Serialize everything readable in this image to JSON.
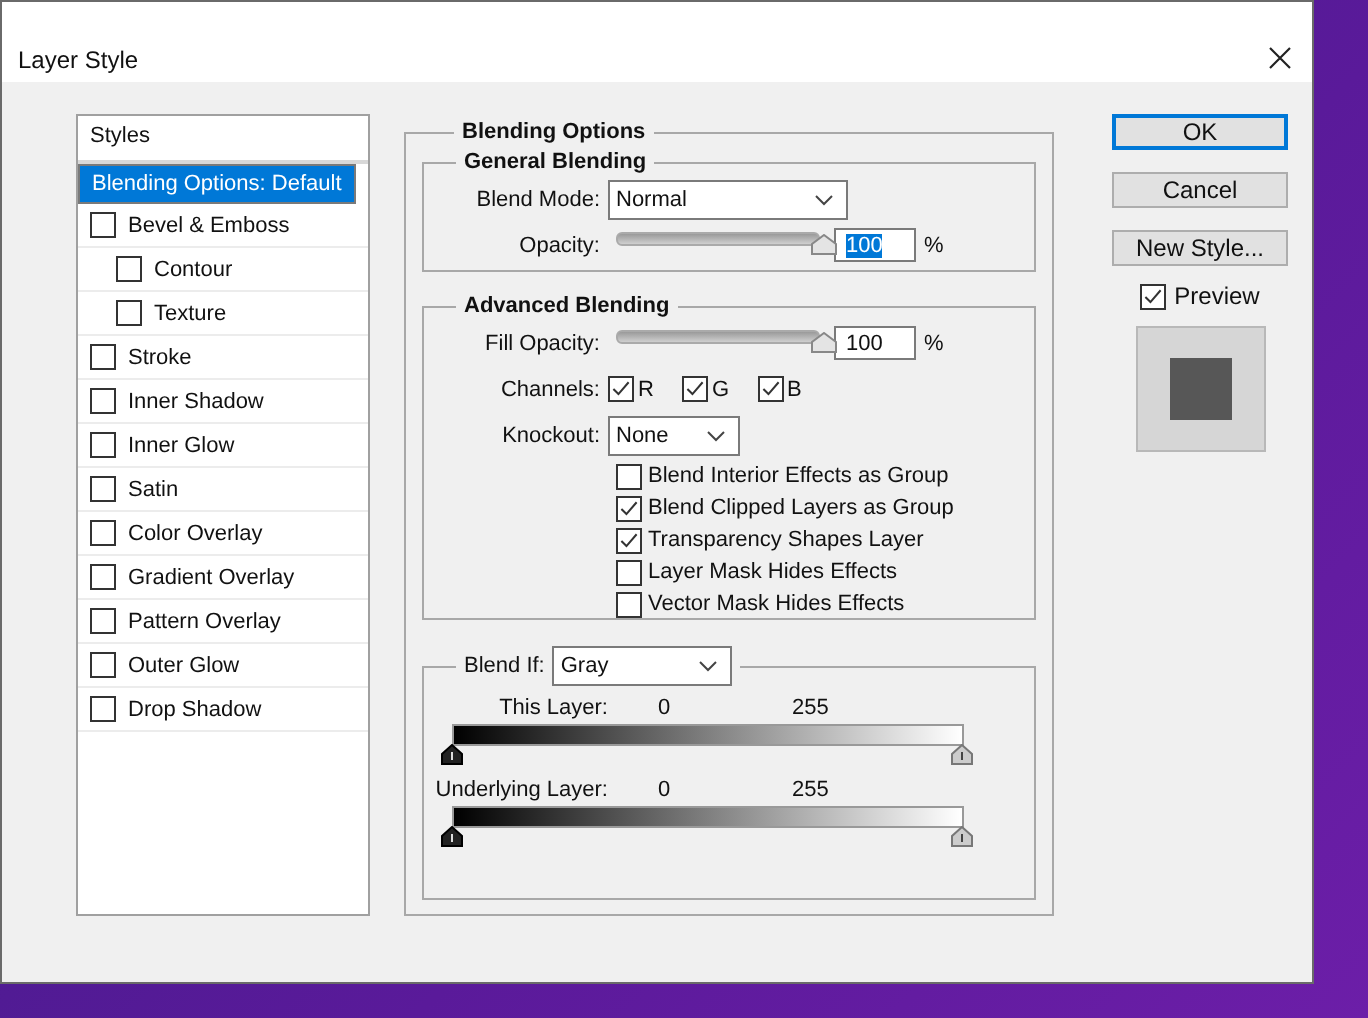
{
  "window": {
    "title": "Layer Style"
  },
  "styles_panel": {
    "header": "Styles",
    "items": [
      {
        "label": "Blending Options: Default",
        "kind": "heading",
        "selected": true
      },
      {
        "label": "Bevel & Emboss",
        "kind": "checkbox",
        "checked": false,
        "selected": false,
        "children": [
          {
            "label": "Contour",
            "kind": "checkbox",
            "checked": false,
            "selected": false
          },
          {
            "label": "Texture",
            "kind": "checkbox",
            "checked": false,
            "selected": false
          }
        ]
      },
      {
        "label": "Stroke",
        "kind": "checkbox",
        "checked": false,
        "selected": false
      },
      {
        "label": "Inner Shadow",
        "kind": "checkbox",
        "checked": false,
        "selected": false
      },
      {
        "label": "Inner Glow",
        "kind": "checkbox",
        "checked": false,
        "selected": false
      },
      {
        "label": "Satin",
        "kind": "checkbox",
        "checked": false,
        "selected": false
      },
      {
        "label": "Color Overlay",
        "kind": "checkbox",
        "checked": false,
        "selected": false
      },
      {
        "label": "Gradient Overlay",
        "kind": "checkbox",
        "checked": false,
        "selected": false
      },
      {
        "label": "Pattern Overlay",
        "kind": "checkbox",
        "checked": false,
        "selected": false
      },
      {
        "label": "Outer Glow",
        "kind": "checkbox",
        "checked": false,
        "selected": false
      },
      {
        "label": "Drop Shadow",
        "kind": "checkbox",
        "checked": false,
        "selected": false
      }
    ]
  },
  "blending_options": {
    "title": "Blending Options",
    "general_blending": {
      "title": "General Blending",
      "blend_mode": {
        "label": "Blend Mode:",
        "value": "Normal"
      },
      "opacity": {
        "label": "Opacity:",
        "level": 1,
        "value": "100",
        "unit": "%",
        "highlighted": true
      }
    },
    "advanced_blending": {
      "title": "Advanced Blending",
      "fill_opacity": {
        "label": "Fill Opacity:",
        "level": 1,
        "value": "100",
        "unit": "%",
        "highlighted": false
      },
      "channels": {
        "label": "Channels:",
        "items": [
          {
            "label": "R",
            "checked": true
          },
          {
            "label": "G",
            "checked": true
          },
          {
            "label": "B",
            "checked": true
          }
        ]
      },
      "knockout": {
        "label": "Knockout:",
        "value": "None"
      },
      "options": [
        {
          "label": "Blend Interior Effects as Group",
          "checked": false
        },
        {
          "label": "Blend Clipped Layers as Group",
          "checked": true
        },
        {
          "label": "Transparency Shapes Layer",
          "checked": true
        },
        {
          "label": "Layer Mask Hides Effects",
          "checked": false
        },
        {
          "label": "Vector Mask Hides Effects",
          "checked": false
        }
      ]
    },
    "blend_if": {
      "label": "Blend If:",
      "value": "Gray",
      "sliders": [
        {
          "label": "This Layer:",
          "min": "0",
          "max": "255"
        },
        {
          "label": "Underlying Layer:",
          "min": "0",
          "max": "255"
        }
      ]
    }
  },
  "buttons": [
    {
      "label": "OK",
      "default": true
    },
    {
      "label": "Cancel",
      "default": false
    },
    {
      "label": "New Style...",
      "default": false
    }
  ],
  "preview": {
    "label": "Preview",
    "checked": true
  }
}
